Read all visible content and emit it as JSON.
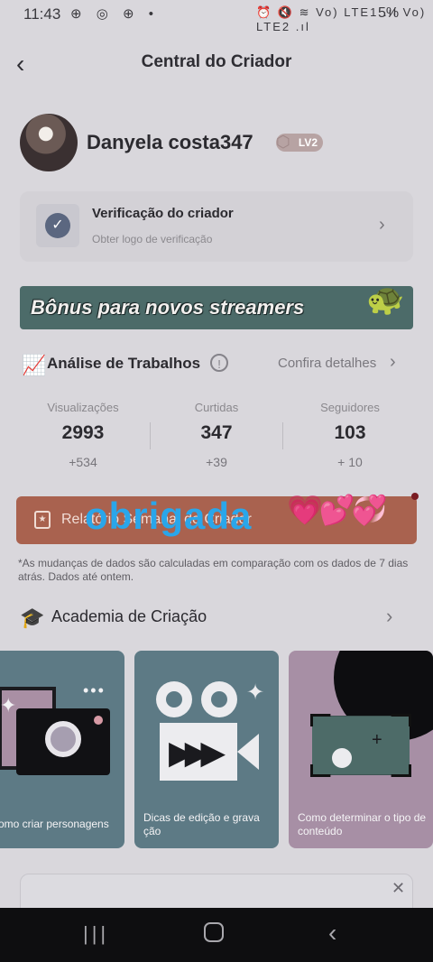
{
  "status_bar": {
    "time": "11:43",
    "left_icons": "⊕ ◎ ⊕ •",
    "right_icons": "⏰ 🔇 ≋ Vo) LTE1 .ıl Vo) LTE2 .ıl",
    "battery": "5%"
  },
  "header": {
    "title": "Central do Criador",
    "back_icon": "‹"
  },
  "profile": {
    "username": "Danyela costa347",
    "level": "LV2"
  },
  "verification": {
    "title": "Verificação do criador",
    "subtitle": "Obter logo de verificação"
  },
  "banner": {
    "text": "Bônus para novos streamers"
  },
  "analysis": {
    "title": "Análise de Trabalhos",
    "details_link": "Confira detalhes",
    "stats": [
      {
        "label": "Visualizações",
        "value": "2993",
        "delta": "+534"
      },
      {
        "label": "Curtidas",
        "value": "347",
        "delta": "+39"
      },
      {
        "label": "Seguidores",
        "value": "103",
        "delta": "+ 10"
      }
    ]
  },
  "report": {
    "label": "Relatório Semanal do Criador",
    "overlay_text": "obrigada",
    "hearts": "💗💕💞"
  },
  "note": "*As mudanças de dados são calculadas em comparação com os dados de 7 dias atrás. Dados até ontem.",
  "academy": {
    "title": "Academia de Criação",
    "cards": [
      {
        "label": "omo criar personagens",
        "bg": "#5d7a85"
      },
      {
        "label": "Dicas de edição e grava ção",
        "bg": "#5d7a85"
      },
      {
        "label": "Como determinar o tipo de conteúdo",
        "bg": "#a78fa5"
      }
    ]
  },
  "colors": {
    "accent_report": "#a9624f",
    "overlay_text": "#2aa6ea",
    "banner_bg": "#4c6b69"
  }
}
